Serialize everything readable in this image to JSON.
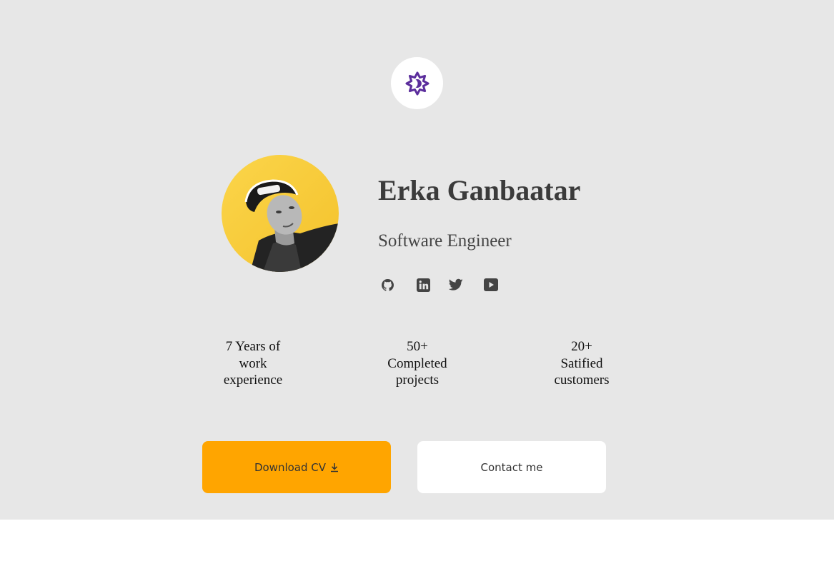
{
  "profile": {
    "name": "Erka Ganbaatar",
    "title": "Software Engineer"
  },
  "theme_toggle_icon": "dark-mode-icon",
  "social_icons": [
    "github-icon",
    "linkedin-icon",
    "twitter-icon",
    "youtube-icon"
  ],
  "stats": [
    {
      "lines": [
        "7 Years of",
        "work",
        "experience"
      ]
    },
    {
      "lines": [
        "50+",
        "Completed",
        "projects"
      ]
    },
    {
      "lines": [
        "20+",
        "Satified",
        "customers"
      ]
    }
  ],
  "buttons": {
    "download_label": "Download CV",
    "download_icon": "download-icon",
    "contact_label": "Contact me"
  },
  "colors": {
    "hero_background": "#e7e7e7",
    "accent": "#ffa500",
    "toggle_icon": "#5b2d9c",
    "avatar_background": "#f9cc3c"
  }
}
